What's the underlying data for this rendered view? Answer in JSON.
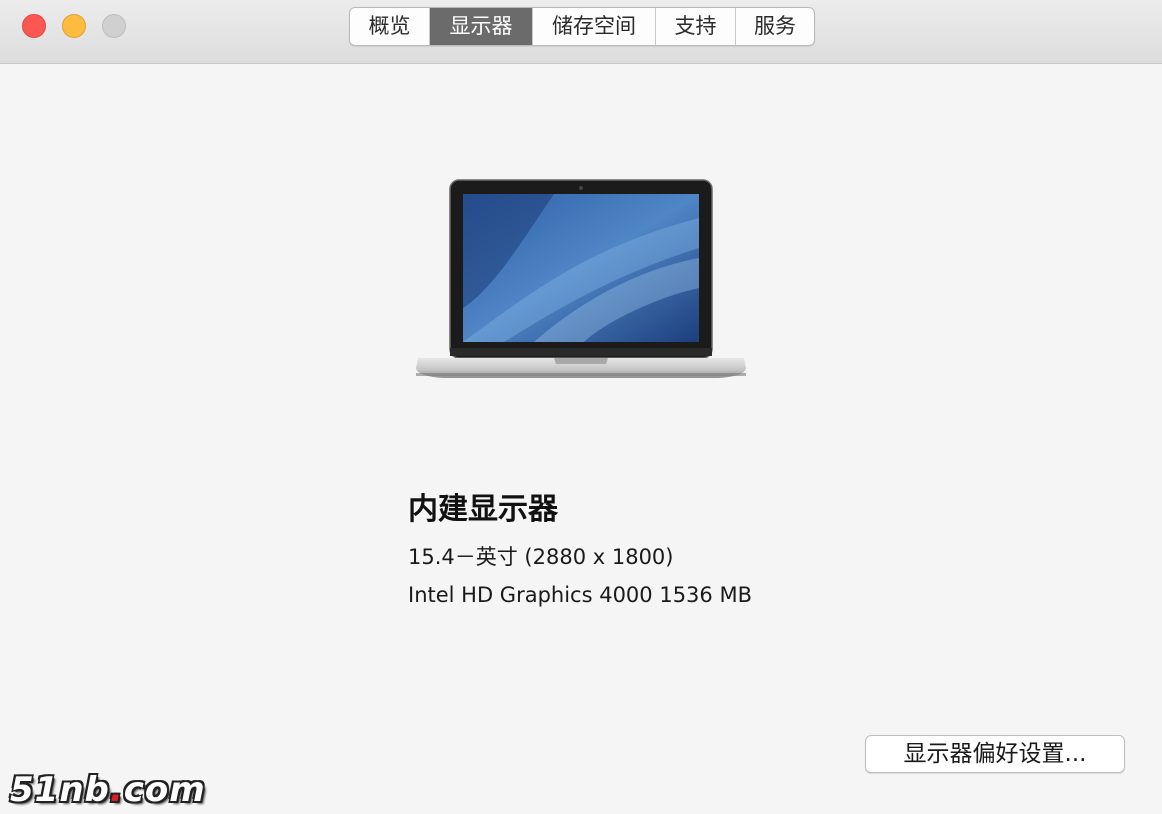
{
  "window": {
    "tabs": [
      {
        "label": "概览"
      },
      {
        "label": "显示器"
      },
      {
        "label": "储存空间"
      },
      {
        "label": "支持"
      },
      {
        "label": "服务"
      }
    ],
    "active_tab": "显示器"
  },
  "display": {
    "name": "内建显示器",
    "size_resolution": "15.4－英寸 (2880 x 1800)",
    "graphics": "Intel HD Graphics 4000 1536 MB"
  },
  "actions": {
    "prefs_button": "显示器偏好设置..."
  },
  "watermark": {
    "text_before": "51nb",
    "dot": ".",
    "text_after": "com"
  },
  "colors": {
    "close": "#fc5753",
    "minimize": "#fdbc40",
    "zoom": "#d0d0d0",
    "active_tab": "#6b6b6b"
  }
}
